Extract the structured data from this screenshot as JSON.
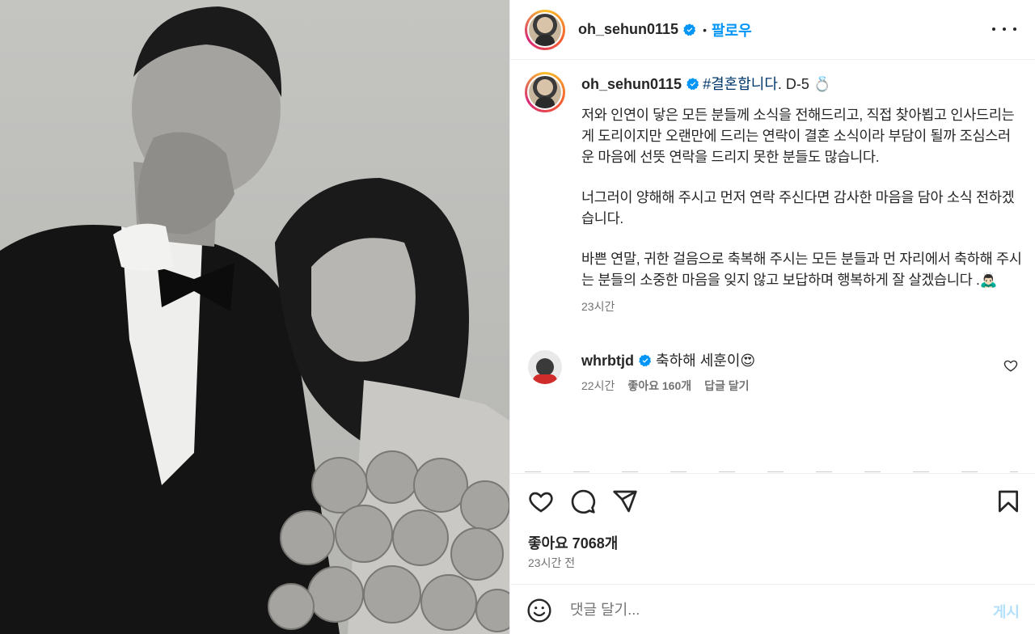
{
  "post": {
    "username": "oh_sehun0115",
    "follow_label": "팔로우",
    "dot": "•"
  },
  "caption": {
    "username": "oh_sehun0115",
    "hashtag": "#결혼합니다",
    "after_hashtag": ". D-5",
    "ring_emoji": "💍",
    "paragraphs": [
      "저와 인연이 닿은 모든 분들께 소식을 전해드리고, 직접 찾아뵙고 인사드리는게 도리이지만 오랜만에 드리는 연락이 결혼 소식이라 부담이 될까 조심스러운 마음에 선뜻 연락을 드리지 못한 분들도 많습니다.",
      "너그러이 양해해 주시고 먼저 연락 주신다면 감사한 마음을 담아 소식 전하겠습니다.",
      "바쁜 연말, 귀한 걸음으로 축복해 주시는 모든 분들과 먼 자리에서 축하해 주시는 분들의 소중한 마음을 잊지 않고 보답하며 행복하게 잘 살겠습니다 .🙇🏻‍♂️"
    ],
    "time": "23시간"
  },
  "comments": [
    {
      "username": "whrbtjd",
      "text": "축하해 세훈이😍",
      "time": "22시간",
      "likes": "좋아요 160개",
      "reply": "답글 달기"
    }
  ],
  "actions": {
    "likes": "좋아요 7068개",
    "posted": "23시간 전"
  },
  "comment_box": {
    "placeholder": "댓글 달기...",
    "post_label": "게시"
  },
  "colors": {
    "accent": "#0095f6",
    "hashtag": "#00376b",
    "muted": "#737373"
  },
  "icons": [
    "verified-badge-icon",
    "more-options-icon",
    "heart-icon",
    "comment-icon",
    "share-icon",
    "bookmark-icon",
    "emoji-icon"
  ]
}
